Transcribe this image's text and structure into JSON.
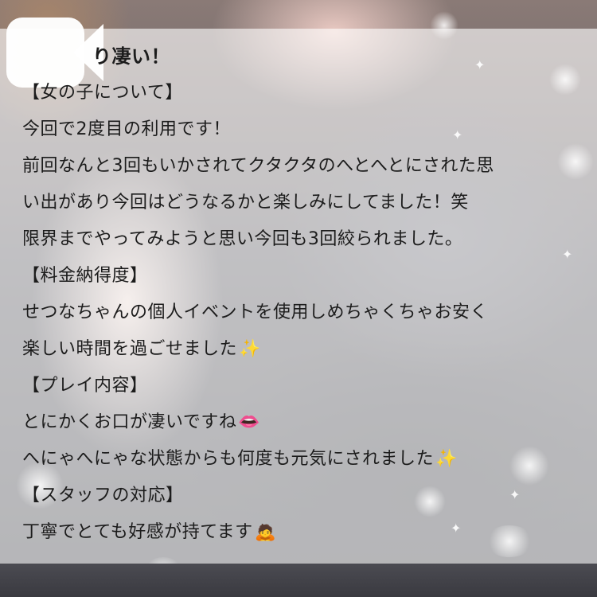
{
  "review": {
    "title": "り凄い！",
    "lines": [
      "【女の子について】",
      "今回で2度目の利用です！",
      "前回なんと3回もいかされてクタクタのへとへとにされた思",
      "い出があり今回はどうなるかと楽しみにしてました！笑",
      "限界までやってみようと思い今回も3回絞られました。",
      "【料金納得度】",
      "せつなちゃんの個人イベントを使用しめちゃくちゃお安く",
      "楽しい時間を過ごせました",
      "【プレイ内容】",
      "とにかくお口が凄いですね",
      "へにゃへにゃな状態からも何度も元気にされました",
      "【スタッフの対応】",
      "丁寧でとても好感が持てます"
    ]
  },
  "emojis": {
    "sparkles": "✨",
    "lips": "👄",
    "person_bowing": "🙇"
  },
  "badge": {
    "icon": "video-camera-icon"
  },
  "colors": {
    "text": "#1c1c1c",
    "panel": "rgba(255,255,255,0.62)"
  }
}
